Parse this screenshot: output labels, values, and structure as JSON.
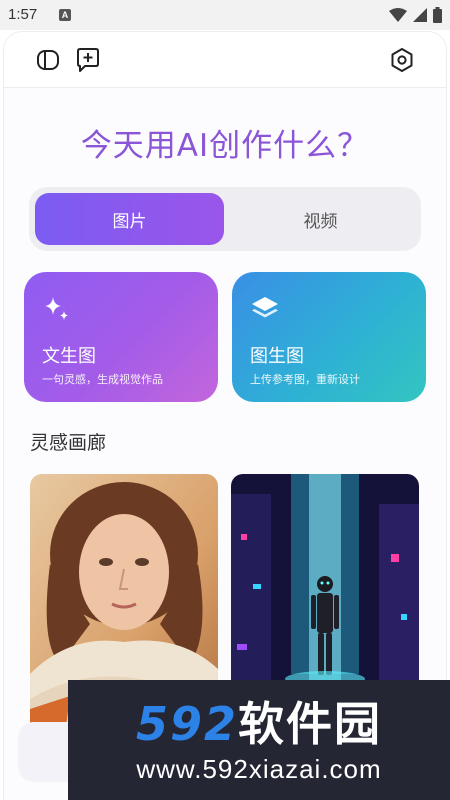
{
  "status_bar": {
    "time": "1:57",
    "notification_badge": "A"
  },
  "toolbar": {
    "icons": [
      "sidebar-toggle-icon",
      "new-chat-icon",
      "settings-icon"
    ]
  },
  "headline": "今天用AI创作什么？",
  "tabs": [
    {
      "label": "图片",
      "active": true
    },
    {
      "label": "视频",
      "active": false
    }
  ],
  "features": [
    {
      "title": "文生图",
      "subtitle": "一句灵感，生成视觉作品",
      "icon": "sparkle-icon"
    },
    {
      "title": "图生图",
      "subtitle": "上传参考图，重新设计",
      "icon": "layers-icon"
    }
  ],
  "gallery": {
    "title": "灵感画廊",
    "items": [
      {
        "subject": "portrait-woman-scarf"
      },
      {
        "subject": "robot-cyber-city"
      }
    ]
  },
  "watermark": {
    "logo_numbers": "592",
    "logo_text": "软件园",
    "url": "www.592xiazai.com"
  },
  "colors": {
    "accent": "#8a55d6",
    "tab_active": "#7b5cf2",
    "card_blue": "#2eb0d5"
  }
}
